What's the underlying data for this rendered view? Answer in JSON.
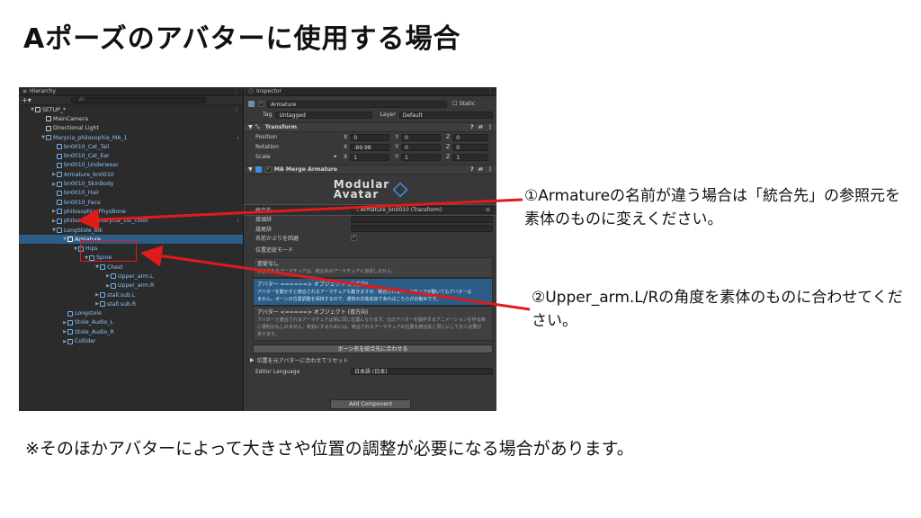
{
  "slide": {
    "title": "Aポーズのアバターに使用する場合",
    "callout1": "①Armatureの名前が違う場合は「統合先」の参照元を素体のものに変えください。",
    "callout2": "②Upper_arm.L/Rの角度を素体のものに合わせてください。",
    "note": "※そのほかアバターによって大きさや位置の調整が必要になる場合があります。"
  },
  "hierarchy": {
    "tab": "Hierarchy",
    "search_placeholder": "All",
    "items": [
      {
        "label": "SETUP_*"
      },
      {
        "label": "MainCamera"
      },
      {
        "label": "Directional Light"
      },
      {
        "label": "Marycia_philosophia_MA_1"
      },
      {
        "label": "bn0010_Cat_Tail"
      },
      {
        "label": "bn0010_Cat_Ear"
      },
      {
        "label": "bn0010_Underwear"
      },
      {
        "label": "Armature_bn0010"
      },
      {
        "label": "bn0010_SkinBody"
      },
      {
        "label": "bn0010_Hair"
      },
      {
        "label": "bn0010_Face"
      },
      {
        "label": "philosophia_PhysBone"
      },
      {
        "label": "philosophia_Marycia_1st_color"
      },
      {
        "label": "LongStole_blk"
      },
      {
        "label": "Armature"
      },
      {
        "label": "Hips"
      },
      {
        "label": "Spine"
      },
      {
        "label": "Chest"
      },
      {
        "label": "Upper_arm.L"
      },
      {
        "label": "Upper_arm.R"
      },
      {
        "label": "stall.sub.L"
      },
      {
        "label": "stall.sub.R"
      },
      {
        "label": "Longstole"
      },
      {
        "label": "Stole_Audio_L"
      },
      {
        "label": "Stole_Audio_R"
      },
      {
        "label": "Collider"
      }
    ]
  },
  "inspector": {
    "tab": "Inspector",
    "object_name": "Armature",
    "static_label": "Static",
    "tag_label": "Tag",
    "tag_value": "Untagged",
    "layer_label": "Layer",
    "layer_value": "Default",
    "transform": {
      "title": "Transform",
      "position_label": "Position",
      "rotation_label": "Rotation",
      "scale_label": "Scale",
      "position": [
        "0",
        "0",
        "0"
      ],
      "rotation": [
        "-89.98",
        "0",
        "0"
      ],
      "scale": [
        "1",
        "1",
        "1"
      ]
    },
    "merge": {
      "title": "MA Merge Armature",
      "logo_line1": "Modular",
      "logo_line2": "Avatar",
      "target_label": "統合先",
      "target_value": "Armature_bn0010 (Transform)",
      "prefix_label": "接頭辞",
      "suffix_label": "接尾辞",
      "avoid_label": "名前かぶりを回避",
      "mode_label": "位置追従モード",
      "mode_none_title": "追従なし",
      "mode_none_desc": "統合されるアーマチュアは、統合先のアーマチュアに追従しません。",
      "mode_one_title": "アバター ======> オブジェクト (片方向)",
      "mode_one_desc1": "アバターを動かすと統合されるアーマチュアも動きますが、統合されるアーマチュアが動いてもアバターは",
      "mode_one_desc2": "ません。ボーンの位置調整を保持するので、通常の衣装追加であればこちらがお勧めです。",
      "mode_two_title": "アバター <=====> オブジェクト (双方向)",
      "mode_two_desc1": "アバターと統合されるアーマチュアは常に同じ位置になります。元のアバターを操作するアニメーションを作る時",
      "mode_two_desc2": "に便利かもしれません。有効にするためには、統合されるアーマチュアの位置を統合先と同じにしておく必要が",
      "mode_two_desc3": "あります。",
      "bone_button": "ボーン名を統合先に合わせる",
      "reset_label": "位置を元アバターに合わせてリセット",
      "lang_label": "Editor Language",
      "lang_value": "日本語 (日本)"
    },
    "add_component": "Add Component"
  },
  "colors": {
    "arrow_red": "#e01b1b",
    "selection_blue": "#2c5d87",
    "unity_dark": "#383838"
  }
}
